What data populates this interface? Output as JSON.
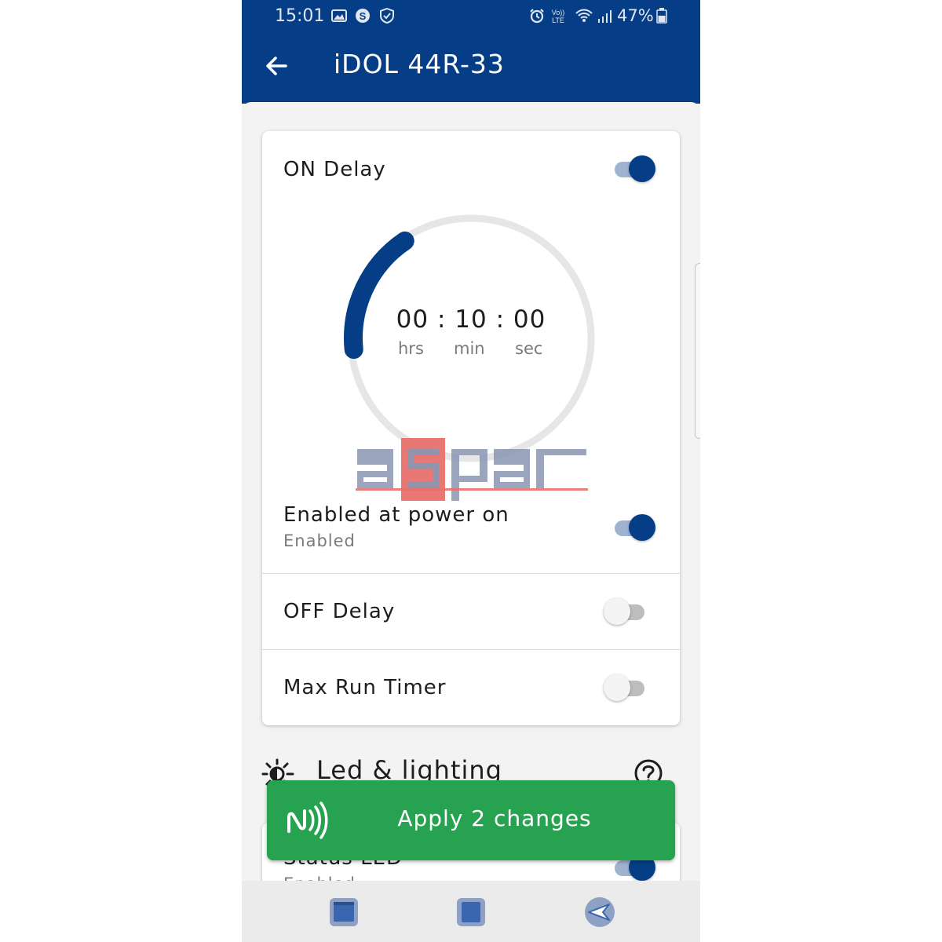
{
  "status_bar": {
    "time": "15:01",
    "battery": "47%",
    "icons": [
      "image-icon",
      "skype-icon",
      "shield-icon",
      "alarm-icon",
      "volte-icon",
      "wifi-icon",
      "signal-icon",
      "battery-icon"
    ]
  },
  "app_bar": {
    "title": "iDOL 44R-33",
    "back_icon": "arrow-left-icon"
  },
  "colors": {
    "primary": "#053e87",
    "apply_green": "#27a251",
    "toggle_on_track": "#9fb3d1"
  },
  "on_delay": {
    "label": "ON Delay",
    "enabled": true,
    "time": "00 : 10 : 00",
    "units": {
      "hrs": "hrs",
      "min": "min",
      "sec": "sec"
    },
    "dial_fill_fraction": 0.17
  },
  "power_on": {
    "label": "Enabled at power on",
    "status": "Enabled",
    "enabled": true
  },
  "off_delay": {
    "label": "OFF Delay",
    "enabled": false
  },
  "max_run": {
    "label": "Max Run Timer",
    "enabled": false
  },
  "led_section": {
    "title": "Led & lighting",
    "icon": "sun-icon",
    "help_icon": "question-circle-icon",
    "status_led": {
      "label": "Status LED",
      "status": "Enabled",
      "enabled": true
    }
  },
  "apply": {
    "label": "Apply 2 changes",
    "icon": "nfc-icon"
  },
  "watermark": "aspar",
  "bottom_nav": [
    "recent-apps-icon",
    "home-icon",
    "back-icon"
  ]
}
